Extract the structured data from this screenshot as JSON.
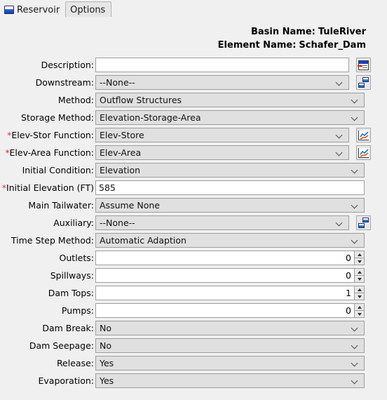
{
  "tabs": [
    {
      "label": "Reservoir",
      "icon": "reservoir-icon",
      "active": true
    },
    {
      "label": "Options",
      "icon": "",
      "active": false
    }
  ],
  "header": {
    "basin_label": "Basin Name:",
    "basin_value": "TuleRiver",
    "element_label": "Element Name:",
    "element_value": "Schafer_Dam"
  },
  "colors": {
    "required_marker": "#e03030",
    "combo_background": "#e0e0e0",
    "text_background": "#ffffff",
    "panel_background": "#f0f0f0",
    "border": "#9e9e9e"
  },
  "fields": [
    {
      "label": "Description:",
      "required": false,
      "type": "text",
      "value": "",
      "side_button": "description-note-icon"
    },
    {
      "label": "Downstream:",
      "required": false,
      "type": "combo",
      "value": "--None--",
      "side_button": "reservoir-pair-icon"
    },
    {
      "label": "Method:",
      "required": false,
      "type": "combo",
      "value": "Outflow Structures",
      "side_button": ""
    },
    {
      "label": "Storage Method:",
      "required": false,
      "type": "combo",
      "value": "Elevation-Storage-Area",
      "side_button": ""
    },
    {
      "label": "Elev-Stor Function:",
      "required": true,
      "type": "combo",
      "value": "Elev-Store",
      "side_button": "chart-icon"
    },
    {
      "label": "Elev-Area Function:",
      "required": true,
      "type": "combo",
      "value": "Elev-Area",
      "side_button": "chart-icon"
    },
    {
      "label": "Initial Condition:",
      "required": false,
      "type": "combo",
      "value": "Elevation",
      "side_button": ""
    },
    {
      "label": "Initial Elevation (FT)",
      "required": true,
      "type": "text",
      "value": "585",
      "side_button": ""
    },
    {
      "label": "Main Tailwater:",
      "required": false,
      "type": "combo",
      "value": "Assume None",
      "side_button": ""
    },
    {
      "label": "Auxiliary:",
      "required": false,
      "type": "combo",
      "value": "--None--",
      "side_button": "reservoir-pair-icon"
    },
    {
      "label": "Time Step Method:",
      "required": false,
      "type": "combo",
      "value": "Automatic Adaption",
      "side_button": ""
    },
    {
      "label": "Outlets:",
      "required": false,
      "type": "spinner",
      "value": "0",
      "side_button": ""
    },
    {
      "label": "Spillways:",
      "required": false,
      "type": "spinner",
      "value": "0",
      "side_button": ""
    },
    {
      "label": "Dam Tops:",
      "required": false,
      "type": "spinner",
      "value": "1",
      "side_button": ""
    },
    {
      "label": "Pumps:",
      "required": false,
      "type": "spinner",
      "value": "0",
      "side_button": ""
    },
    {
      "label": "Dam Break:",
      "required": false,
      "type": "combo",
      "value": "No",
      "side_button": ""
    },
    {
      "label": "Dam Seepage:",
      "required": false,
      "type": "combo",
      "value": "No",
      "side_button": ""
    },
    {
      "label": "Release:",
      "required": false,
      "type": "combo",
      "value": "Yes",
      "side_button": ""
    },
    {
      "label": "Evaporation:",
      "required": false,
      "type": "combo",
      "value": "Yes",
      "side_button": ""
    }
  ]
}
